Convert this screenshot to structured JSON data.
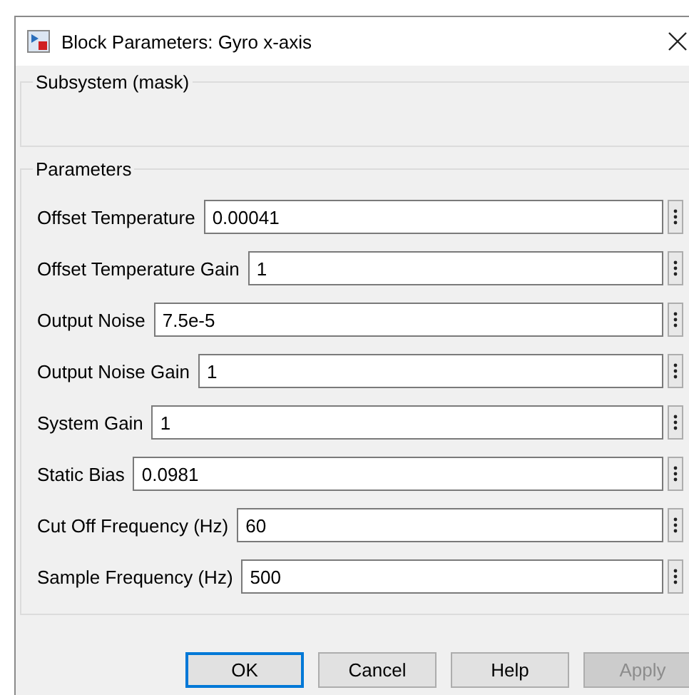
{
  "window": {
    "title": "Block Parameters: Gyro x-axis"
  },
  "mask_group": {
    "title": "Subsystem (mask)"
  },
  "parameters_group": {
    "title": "Parameters",
    "fields": [
      {
        "label": "Offset Temperature",
        "value": "0.00041"
      },
      {
        "label": "Offset Temperature Gain",
        "value": "1"
      },
      {
        "label": "Output Noise",
        "value": "7.5e-5"
      },
      {
        "label": "Output Noise Gain",
        "value": "1"
      },
      {
        "label": "System Gain",
        "value": "1"
      },
      {
        "label": "Static Bias",
        "value": "0.0981"
      },
      {
        "label": "Cut Off Frequency (Hz)",
        "value": "60"
      },
      {
        "label": "Sample Frequency (Hz)",
        "value": "500"
      }
    ]
  },
  "buttons": [
    {
      "label": "OK",
      "default": true,
      "disabled": false
    },
    {
      "label": "Cancel",
      "default": false,
      "disabled": false
    },
    {
      "label": "Help",
      "default": false,
      "disabled": false
    },
    {
      "label": "Apply",
      "default": false,
      "disabled": true
    }
  ]
}
